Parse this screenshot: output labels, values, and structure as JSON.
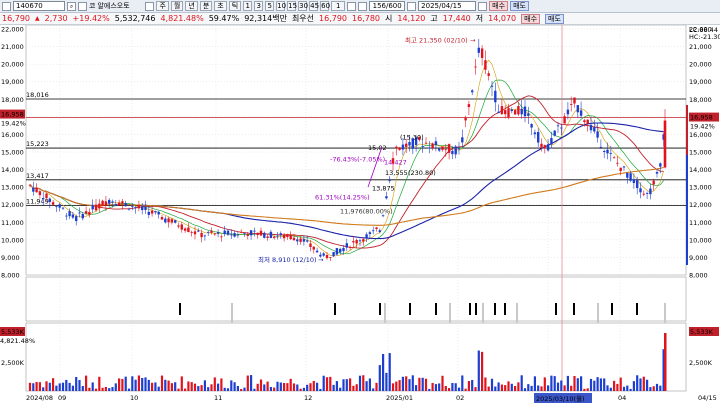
{
  "toolbar": {
    "code": "140670",
    "search_icon": "search-icon",
    "marker": "코",
    "name": "알에스오토",
    "periods": [
      "주",
      "월",
      "년",
      "분",
      "초",
      "틱"
    ],
    "intervals": [
      "1",
      "3",
      "5",
      "10",
      "15",
      "30",
      "45",
      "60"
    ],
    "page": "156/600",
    "date": "2025/04/15",
    "buy": "매수",
    "sell": "매도"
  },
  "info": {
    "price": "16,790",
    "change": "2,730",
    "change_pct": "+19.42%",
    "volume": "5,532,746",
    "vol_pct": "4,821.48%",
    "turnover": "59.47%",
    "amount": "92,314백만",
    "quote_label": "최우선",
    "ask": "16,790",
    "bid": "16,780",
    "open_label": "시",
    "open": "14,120",
    "high_label": "고",
    "high": "17,440",
    "low_label": "저",
    "low": "14,070"
  },
  "chart_data": {
    "type": "candlestick",
    "price_axis": [
      "22,000",
      "21,000",
      "20,000",
      "19,000",
      "18,000",
      "17,000",
      "16,000",
      "15,000",
      "14,000",
      "13,000",
      "12,000",
      "11,000",
      "10,000",
      "9,000",
      "8,000"
    ],
    "time_axis": [
      "2024/08",
      "09",
      "10",
      "11",
      "12",
      "2025/01",
      "02",
      "03",
      "04",
      "04/15"
    ],
    "right_badges": {
      "lc": "LC:88.44",
      "hc": "HC:-21.30",
      "price": "16,958",
      "price_pct": "19.42%"
    },
    "left_badges": {
      "price": "16,958",
      "price_pct": "19.42%"
    },
    "levels": [
      {
        "label": "18,016",
        "value": 18016
      },
      {
        "label": "15,223",
        "value": 15223
      },
      {
        "label": "13,417",
        "value": 13417
      },
      {
        "label": "11,949",
        "value": 11949
      }
    ],
    "annotations": {
      "high": "최고 21,350 (02/10)",
      "low": "최저 8,910 (12/10)",
      "a1": "15,02",
      "a2": "(15.30)",
      "a3": "-76.43%(-7.05%)",
      "a4": "14,427",
      "a5": "13,555",
      "a6": "(230.80)",
      "a7": "13,875",
      "a8": "61.31%(14.25%)",
      "a9": "11,976(80.00%)"
    },
    "volume_axis": [
      "2,500K"
    ],
    "volume_badges": {
      "left": "5,533K",
      "left_pct": "4,821.48%",
      "right": "5,533K"
    },
    "cursor_date": "2025/03/10(월)",
    "candles": []
  }
}
